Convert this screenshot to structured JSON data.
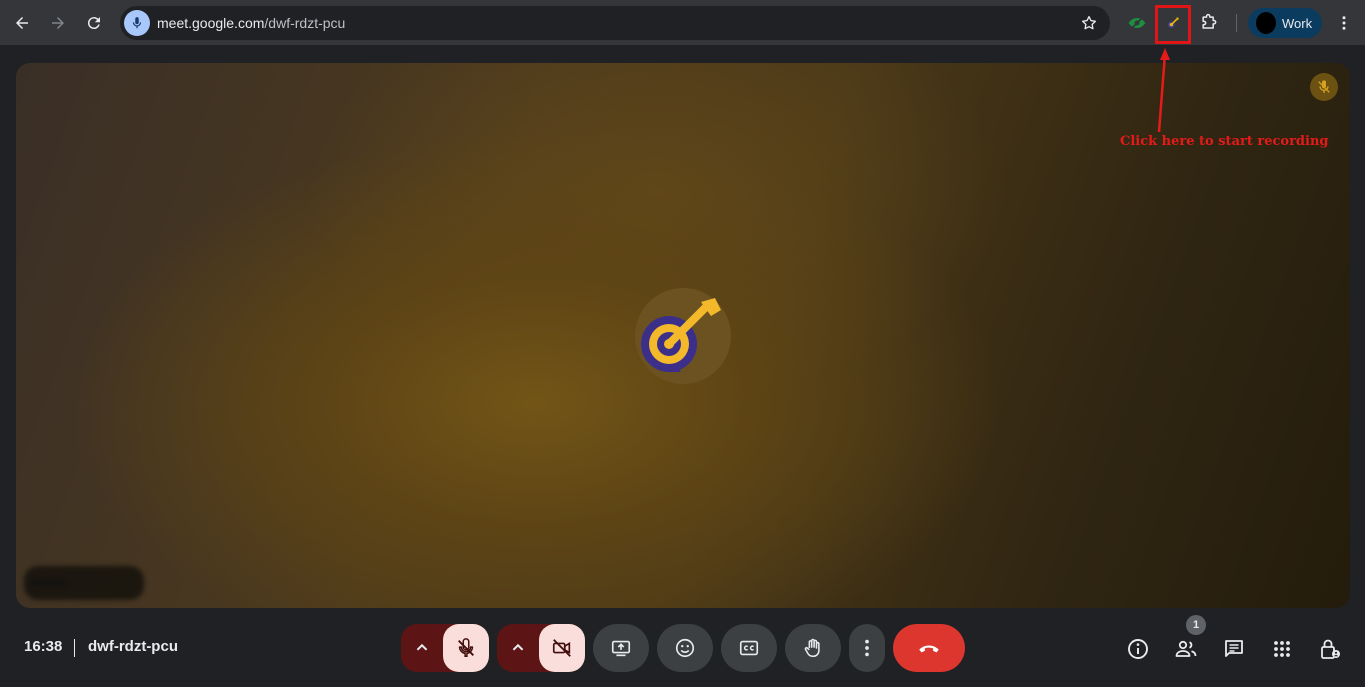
{
  "browser": {
    "url_host": "meet.google.com",
    "url_path": "/dwf-rdzt-pcu",
    "profile_label": "Work"
  },
  "annotation": {
    "text": "Click here to start recording",
    "color": "#e51b1b"
  },
  "meeting": {
    "time": "16:38",
    "code": "dwf-rdzt-pcu",
    "participant_name": "••••••••"
  },
  "controls": {
    "people_count": "1",
    "end_call_color": "#dc362e",
    "mic_state": "off",
    "camera_state": "off"
  },
  "icons": {
    "back": "arrow-left-icon",
    "forward": "arrow-right-icon",
    "reload": "reload-icon",
    "site": "mic-icon",
    "bookmark": "star-icon",
    "eye_extension": "eye-extension-icon",
    "recorder_extension": "recorder-extension-icon",
    "extensions": "puzzle-icon",
    "menu": "more-vert-icon"
  }
}
